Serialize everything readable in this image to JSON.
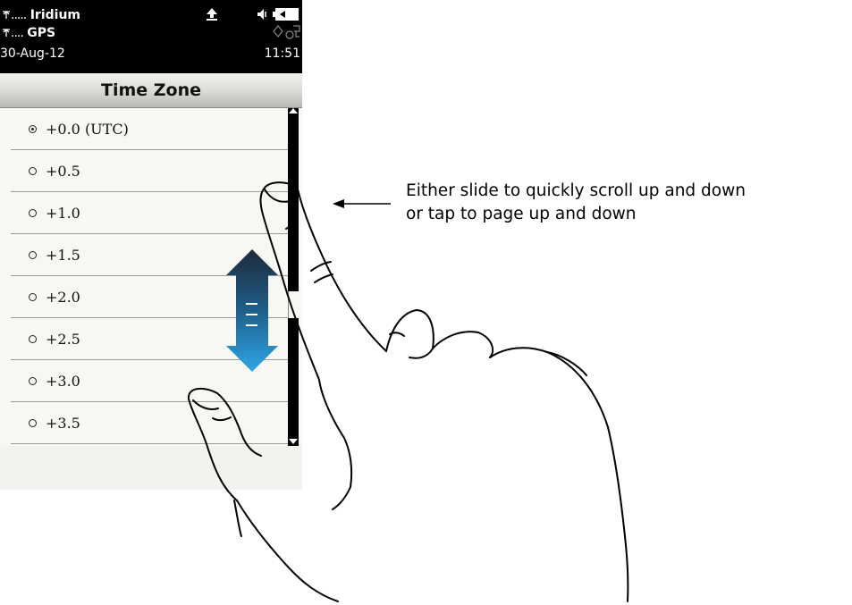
{
  "status_bar": {
    "iridium_label": "Iridium",
    "gps_label": "GPS",
    "date": "30-Aug-12",
    "time": "11:51"
  },
  "screen": {
    "title": "Time Zone",
    "items": [
      {
        "label": "+0.0 (UTC)",
        "selected": true
      },
      {
        "label": "+0.5",
        "selected": false
      },
      {
        "label": "+1.0",
        "selected": false
      },
      {
        "label": "+1.5",
        "selected": false
      },
      {
        "label": "+2.0",
        "selected": false
      },
      {
        "label": "+2.5",
        "selected": false
      },
      {
        "label": "+3.0",
        "selected": false
      },
      {
        "label": "+3.5",
        "selected": false
      }
    ]
  },
  "annotation": {
    "line1": "Either slide to quickly scroll up and down",
    "line2": "or tap to page up and down"
  },
  "colors": {
    "arrow_top": "#1e2a3a",
    "arrow_bottom": "#2ea6e6"
  },
  "icons": [
    "signal-icon",
    "upload-icon",
    "speaker-icon",
    "battery-icon",
    "gps-target-icon",
    "scroll-arrow-icon",
    "hand-pointer-icon"
  ]
}
